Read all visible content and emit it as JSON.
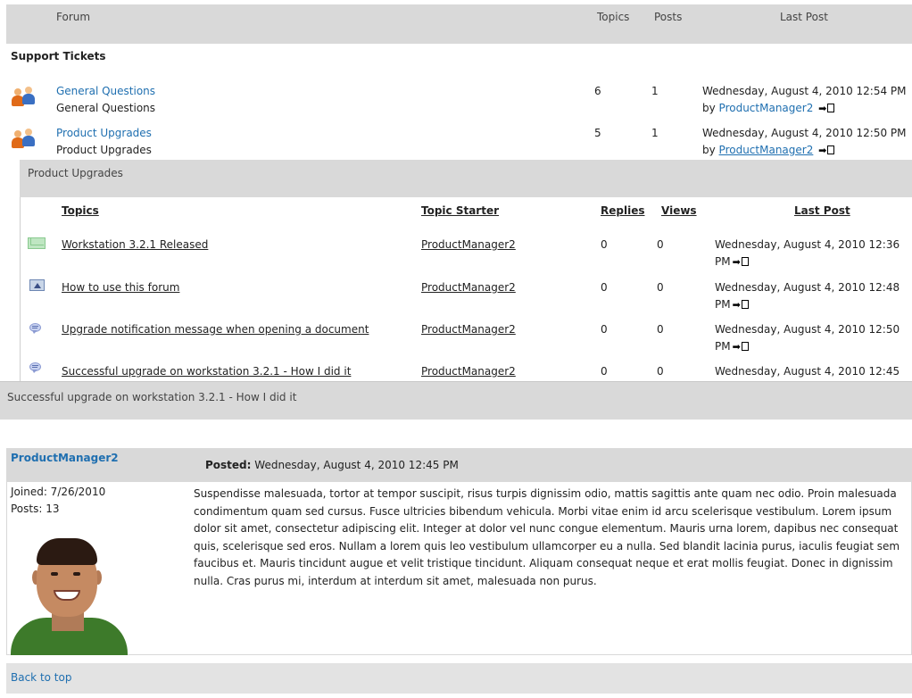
{
  "forum_table": {
    "headers": {
      "forum": "Forum",
      "topics": "Topics",
      "posts": "Posts",
      "last_post": "Last Post"
    },
    "section": "Support Tickets",
    "rows": [
      {
        "title": "General Questions",
        "desc": "General Questions",
        "topics": "6",
        "posts": "1",
        "last_date": "Wednesday, August 4, 2010 12:54 PM",
        "by": "by",
        "author": "ProductManager2"
      },
      {
        "title": "Product Upgrades",
        "desc": "Product Upgrades",
        "topics": "5",
        "posts": "1",
        "last_date": "Wednesday, August 4, 2010 12:50 PM",
        "by": "by",
        "author": "ProductManager2"
      }
    ]
  },
  "topics_panel": {
    "title": "Product Upgrades",
    "headers": {
      "topics": "Topics",
      "starter": "Topic Starter",
      "replies": "Replies",
      "views": "Views",
      "last_post": "Last Post"
    },
    "rows": [
      {
        "icon": "mail-icon",
        "title": "Workstation 3.2.1 Released",
        "starter": "ProductManager2",
        "replies": "0",
        "views": "0",
        "last1": "Wednesday, August 4, 2010 12:36",
        "last2": "PM"
      },
      {
        "icon": "announcement-icon",
        "title": "How to use this forum",
        "starter": "ProductManager2",
        "replies": "0",
        "views": "0",
        "last1": "Wednesday, August 4, 2010 12:48",
        "last2": "PM"
      },
      {
        "icon": "speech-bubble-icon",
        "title": "Upgrade notification message when opening a document",
        "starter": "ProductManager2",
        "replies": "0",
        "views": "0",
        "last1": "Wednesday, August 4, 2010 12:50",
        "last2": "PM"
      },
      {
        "icon": "speech-bubble-icon",
        "title": "Successful upgrade on workstation 3.2.1 - How I did it",
        "starter": "ProductManager2",
        "replies": "0",
        "views": "0",
        "last1": "Wednesday, August 4, 2010 12:45",
        "last2": ""
      }
    ]
  },
  "thread": {
    "title": "Successful upgrade on workstation 3.2.1 - How I did it",
    "author": "ProductManager2",
    "posted_label": "Posted:",
    "posted_date": "Wednesday, August 4, 2010 12:45 PM",
    "joined": "Joined: 7/26/2010",
    "posts": "Posts: 13",
    "body_lines": [
      "Suspendisse malesuada, tortor at tempor suscipit, risus turpis dignissim odio, mattis sagittis ante quam nec odio. Proin malesuada",
      "condimentum quam sed cursus. Fusce ultricies bibendum vehicula. Morbi vitae enim id arcu scelerisque vestibulum. Lorem ipsum",
      "dolor sit amet, consectetur adipiscing elit. Integer at dolor vel nunc congue elementum. Mauris urna lorem, dapibus nec consequat",
      "quis, scelerisque sed eros. Nullam a lorem quis leo vestibulum ullamcorper eu a nulla. Sed blandit lacinia purus, iaculis feugiat sem",
      "faucibus et. Mauris tincidunt augue et velit tristique tincidunt. Aliquam consequat neque et erat mollis feugiat. Donec in dignissim",
      "nulla. Cras purus mi, interdum at interdum sit amet, malesuada non purus."
    ],
    "back_to_top": "Back to top"
  }
}
